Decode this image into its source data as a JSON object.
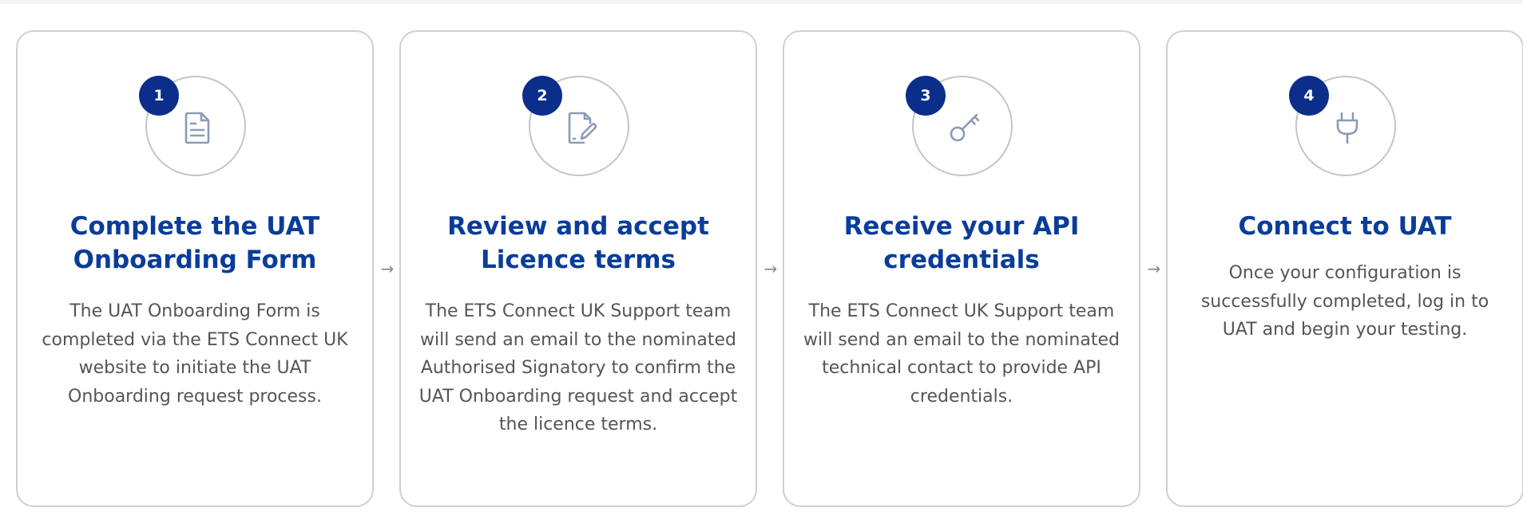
{
  "steps": [
    {
      "number": "1",
      "icon": "document-icon",
      "title": "Complete the UAT Onboarding Form",
      "description": "The UAT Onboarding Form is completed via the ETS Connect UK website to initiate the UAT Onboarding request process."
    },
    {
      "number": "2",
      "icon": "signature-icon",
      "title": "Review and accept Licence terms",
      "description": "The ETS Connect UK Support team will send an email to the nominated Authorised Signatory to confirm the UAT Onboarding request and accept the licence terms."
    },
    {
      "number": "3",
      "icon": "key-icon",
      "title": "Receive your API credentials",
      "description": "The ETS Connect UK Support team will send an email to the nominated technical contact to provide API credentials."
    },
    {
      "number": "4",
      "icon": "plug-icon",
      "title": "Connect to UAT",
      "description": "Once your configuration is successfully completed, log in to UAT and begin your testing."
    }
  ],
  "connector_glyph": "→",
  "colors": {
    "accent": "#0a3d99",
    "badge": "#0a2e8a",
    "border": "#cfd0d3",
    "text": "#545558",
    "icon": "#8a9bb5"
  }
}
